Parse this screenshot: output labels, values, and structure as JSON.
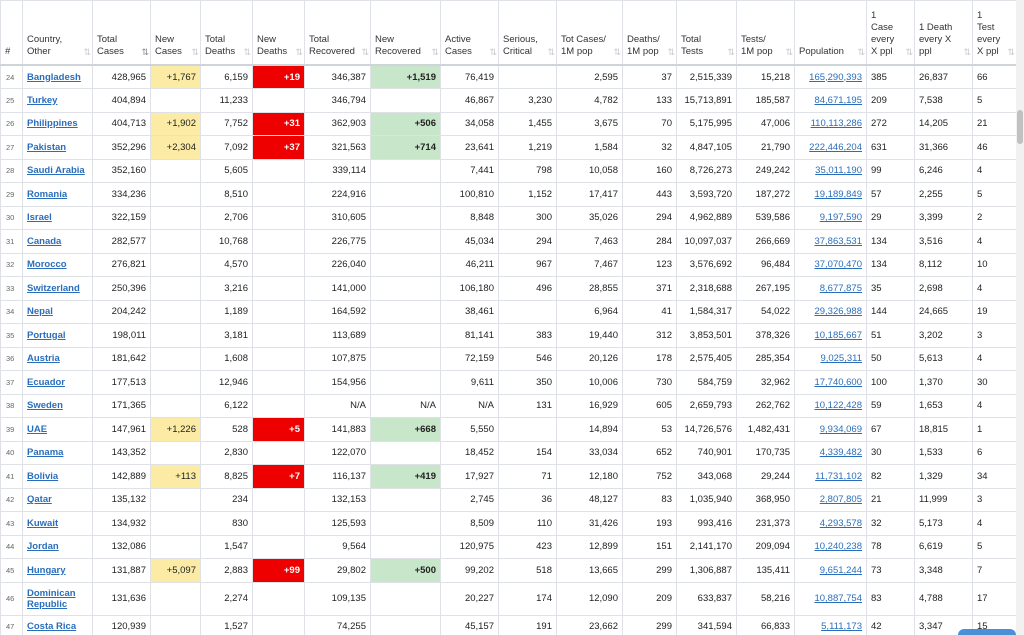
{
  "headers": [
    {
      "label": "#"
    },
    {
      "label": "Country, Other"
    },
    {
      "label": "Total Cases"
    },
    {
      "label": "New Cases"
    },
    {
      "label": "Total Deaths"
    },
    {
      "label": "New Deaths"
    },
    {
      "label": "Total Recovered"
    },
    {
      "label": "New Recovered"
    },
    {
      "label": "Active Cases"
    },
    {
      "label": "Serious, Critical"
    },
    {
      "label": "Tot Cases/ 1M pop"
    },
    {
      "label": "Deaths/ 1M pop"
    },
    {
      "label": "Total Tests"
    },
    {
      "label": "Tests/ 1M pop"
    },
    {
      "label": "Population"
    },
    {
      "label": "1 Case every X ppl"
    },
    {
      "label": "1 Death every X ppl"
    },
    {
      "label": "1 Test every X ppl"
    }
  ],
  "sort_icon": "⇅",
  "rows": [
    {
      "num": "24",
      "country": "Bangladesh",
      "total_cases": "428,965",
      "new_cases": "+1,767",
      "total_deaths": "6,159",
      "new_deaths": "+19",
      "total_recovered": "346,387",
      "new_recovered": "+1,519",
      "active": "76,419",
      "serious": "",
      "cases_1m": "2,595",
      "deaths_1m": "37",
      "tests": "2,515,339",
      "tests_1m": "15,218",
      "population": "165,290,393",
      "case_every": "385",
      "death_every": "26,837",
      "test_every": "66"
    },
    {
      "num": "25",
      "country": "Turkey",
      "total_cases": "404,894",
      "new_cases": "",
      "total_deaths": "11,233",
      "new_deaths": "",
      "total_recovered": "346,794",
      "new_recovered": "",
      "active": "46,867",
      "serious": "3,230",
      "cases_1m": "4,782",
      "deaths_1m": "133",
      "tests": "15,713,891",
      "tests_1m": "185,587",
      "population": "84,671,195",
      "case_every": "209",
      "death_every": "7,538",
      "test_every": "5"
    },
    {
      "num": "26",
      "country": "Philippines",
      "total_cases": "404,713",
      "new_cases": "+1,902",
      "total_deaths": "7,752",
      "new_deaths": "+31",
      "total_recovered": "362,903",
      "new_recovered": "+506",
      "active": "34,058",
      "serious": "1,455",
      "cases_1m": "3,675",
      "deaths_1m": "70",
      "tests": "5,175,995",
      "tests_1m": "47,006",
      "population": "110,113,286",
      "case_every": "272",
      "death_every": "14,205",
      "test_every": "21"
    },
    {
      "num": "27",
      "country": "Pakistan",
      "total_cases": "352,296",
      "new_cases": "+2,304",
      "total_deaths": "7,092",
      "new_deaths": "+37",
      "total_recovered": "321,563",
      "new_recovered": "+714",
      "active": "23,641",
      "serious": "1,219",
      "cases_1m": "1,584",
      "deaths_1m": "32",
      "tests": "4,847,105",
      "tests_1m": "21,790",
      "population": "222,446,204",
      "case_every": "631",
      "death_every": "31,366",
      "test_every": "46"
    },
    {
      "num": "28",
      "country": "Saudi Arabia",
      "total_cases": "352,160",
      "new_cases": "",
      "total_deaths": "5,605",
      "new_deaths": "",
      "total_recovered": "339,114",
      "new_recovered": "",
      "active": "7,441",
      "serious": "798",
      "cases_1m": "10,058",
      "deaths_1m": "160",
      "tests": "8,726,273",
      "tests_1m": "249,242",
      "population": "35,011,190",
      "case_every": "99",
      "death_every": "6,246",
      "test_every": "4"
    },
    {
      "num": "29",
      "country": "Romania",
      "total_cases": "334,236",
      "new_cases": "",
      "total_deaths": "8,510",
      "new_deaths": "",
      "total_recovered": "224,916",
      "new_recovered": "",
      "active": "100,810",
      "serious": "1,152",
      "cases_1m": "17,417",
      "deaths_1m": "443",
      "tests": "3,593,720",
      "tests_1m": "187,272",
      "population": "19,189,849",
      "case_every": "57",
      "death_every": "2,255",
      "test_every": "5"
    },
    {
      "num": "30",
      "country": "Israel",
      "total_cases": "322,159",
      "new_cases": "",
      "total_deaths": "2,706",
      "new_deaths": "",
      "total_recovered": "310,605",
      "new_recovered": "",
      "active": "8,848",
      "serious": "300",
      "cases_1m": "35,026",
      "deaths_1m": "294",
      "tests": "4,962,889",
      "tests_1m": "539,586",
      "population": "9,197,590",
      "case_every": "29",
      "death_every": "3,399",
      "test_every": "2"
    },
    {
      "num": "31",
      "country": "Canada",
      "total_cases": "282,577",
      "new_cases": "",
      "total_deaths": "10,768",
      "new_deaths": "",
      "total_recovered": "226,775",
      "new_recovered": "",
      "active": "45,034",
      "serious": "294",
      "cases_1m": "7,463",
      "deaths_1m": "284",
      "tests": "10,097,037",
      "tests_1m": "266,669",
      "population": "37,863,531",
      "case_every": "134",
      "death_every": "3,516",
      "test_every": "4"
    },
    {
      "num": "32",
      "country": "Morocco",
      "total_cases": "276,821",
      "new_cases": "",
      "total_deaths": "4,570",
      "new_deaths": "",
      "total_recovered": "226,040",
      "new_recovered": "",
      "active": "46,211",
      "serious": "967",
      "cases_1m": "7,467",
      "deaths_1m": "123",
      "tests": "3,576,692",
      "tests_1m": "96,484",
      "population": "37,070,470",
      "case_every": "134",
      "death_every": "8,112",
      "test_every": "10"
    },
    {
      "num": "33",
      "country": "Switzerland",
      "total_cases": "250,396",
      "new_cases": "",
      "total_deaths": "3,216",
      "new_deaths": "",
      "total_recovered": "141,000",
      "new_recovered": "",
      "active": "106,180",
      "serious": "496",
      "cases_1m": "28,855",
      "deaths_1m": "371",
      "tests": "2,318,688",
      "tests_1m": "267,195",
      "population": "8,677,875",
      "case_every": "35",
      "death_every": "2,698",
      "test_every": "4"
    },
    {
      "num": "34",
      "country": "Nepal",
      "total_cases": "204,242",
      "new_cases": "",
      "total_deaths": "1,189",
      "new_deaths": "",
      "total_recovered": "164,592",
      "new_recovered": "",
      "active": "38,461",
      "serious": "",
      "cases_1m": "6,964",
      "deaths_1m": "41",
      "tests": "1,584,317",
      "tests_1m": "54,022",
      "population": "29,326,988",
      "case_every": "144",
      "death_every": "24,665",
      "test_every": "19"
    },
    {
      "num": "35",
      "country": "Portugal",
      "total_cases": "198,011",
      "new_cases": "",
      "total_deaths": "3,181",
      "new_deaths": "",
      "total_recovered": "113,689",
      "new_recovered": "",
      "active": "81,141",
      "serious": "383",
      "cases_1m": "19,440",
      "deaths_1m": "312",
      "tests": "3,853,501",
      "tests_1m": "378,326",
      "population": "10,185,667",
      "case_every": "51",
      "death_every": "3,202",
      "test_every": "3"
    },
    {
      "num": "36",
      "country": "Austria",
      "total_cases": "181,642",
      "new_cases": "",
      "total_deaths": "1,608",
      "new_deaths": "",
      "total_recovered": "107,875",
      "new_recovered": "",
      "active": "72,159",
      "serious": "546",
      "cases_1m": "20,126",
      "deaths_1m": "178",
      "tests": "2,575,405",
      "tests_1m": "285,354",
      "population": "9,025,311",
      "case_every": "50",
      "death_every": "5,613",
      "test_every": "4"
    },
    {
      "num": "37",
      "country": "Ecuador",
      "total_cases": "177,513",
      "new_cases": "",
      "total_deaths": "12,946",
      "new_deaths": "",
      "total_recovered": "154,956",
      "new_recovered": "",
      "active": "9,611",
      "serious": "350",
      "cases_1m": "10,006",
      "deaths_1m": "730",
      "tests": "584,759",
      "tests_1m": "32,962",
      "population": "17,740,600",
      "case_every": "100",
      "death_every": "1,370",
      "test_every": "30"
    },
    {
      "num": "38",
      "country": "Sweden",
      "total_cases": "171,365",
      "new_cases": "",
      "total_deaths": "6,122",
      "new_deaths": "",
      "total_recovered": "N/A",
      "new_recovered": "N/A",
      "active": "N/A",
      "serious": "131",
      "cases_1m": "16,929",
      "deaths_1m": "605",
      "tests": "2,659,793",
      "tests_1m": "262,762",
      "population": "10,122,428",
      "case_every": "59",
      "death_every": "1,653",
      "test_every": "4"
    },
    {
      "num": "39",
      "country": "UAE",
      "total_cases": "147,961",
      "new_cases": "+1,226",
      "total_deaths": "528",
      "new_deaths": "+5",
      "total_recovered": "141,883",
      "new_recovered": "+668",
      "active": "5,550",
      "serious": "",
      "cases_1m": "14,894",
      "deaths_1m": "53",
      "tests": "14,726,576",
      "tests_1m": "1,482,431",
      "population": "9,934,069",
      "case_every": "67",
      "death_every": "18,815",
      "test_every": "1"
    },
    {
      "num": "40",
      "country": "Panama",
      "total_cases": "143,352",
      "new_cases": "",
      "total_deaths": "2,830",
      "new_deaths": "",
      "total_recovered": "122,070",
      "new_recovered": "",
      "active": "18,452",
      "serious": "154",
      "cases_1m": "33,034",
      "deaths_1m": "652",
      "tests": "740,901",
      "tests_1m": "170,735",
      "population": "4,339,482",
      "case_every": "30",
      "death_every": "1,533",
      "test_every": "6"
    },
    {
      "num": "41",
      "country": "Bolivia",
      "total_cases": "142,889",
      "new_cases": "+113",
      "total_deaths": "8,825",
      "new_deaths": "+7",
      "total_recovered": "116,137",
      "new_recovered": "+419",
      "active": "17,927",
      "serious": "71",
      "cases_1m": "12,180",
      "deaths_1m": "752",
      "tests": "343,068",
      "tests_1m": "29,244",
      "population": "11,731,102",
      "case_every": "82",
      "death_every": "1,329",
      "test_every": "34"
    },
    {
      "num": "42",
      "country": "Qatar",
      "total_cases": "135,132",
      "new_cases": "",
      "total_deaths": "234",
      "new_deaths": "",
      "total_recovered": "132,153",
      "new_recovered": "",
      "active": "2,745",
      "serious": "36",
      "cases_1m": "48,127",
      "deaths_1m": "83",
      "tests": "1,035,940",
      "tests_1m": "368,950",
      "population": "2,807,805",
      "case_every": "21",
      "death_every": "11,999",
      "test_every": "3"
    },
    {
      "num": "43",
      "country": "Kuwait",
      "total_cases": "134,932",
      "new_cases": "",
      "total_deaths": "830",
      "new_deaths": "",
      "total_recovered": "125,593",
      "new_recovered": "",
      "active": "8,509",
      "serious": "110",
      "cases_1m": "31,426",
      "deaths_1m": "193",
      "tests": "993,416",
      "tests_1m": "231,373",
      "population": "4,293,578",
      "case_every": "32",
      "death_every": "5,173",
      "test_every": "4"
    },
    {
      "num": "44",
      "country": "Jordan",
      "total_cases": "132,086",
      "new_cases": "",
      "total_deaths": "1,547",
      "new_deaths": "",
      "total_recovered": "9,564",
      "new_recovered": "",
      "active": "120,975",
      "serious": "423",
      "cases_1m": "12,899",
      "deaths_1m": "151",
      "tests": "2,141,170",
      "tests_1m": "209,094",
      "population": "10,240,238",
      "case_every": "78",
      "death_every": "6,619",
      "test_every": "5"
    },
    {
      "num": "45",
      "country": "Hungary",
      "total_cases": "131,887",
      "new_cases": "+5,097",
      "total_deaths": "2,883",
      "new_deaths": "+99",
      "total_recovered": "29,802",
      "new_recovered": "+500",
      "active": "99,202",
      "serious": "518",
      "cases_1m": "13,665",
      "deaths_1m": "299",
      "tests": "1,306,887",
      "tests_1m": "135,411",
      "population": "9,651,244",
      "case_every": "73",
      "death_every": "3,348",
      "test_every": "7"
    },
    {
      "num": "46",
      "country": "Dominican Republic",
      "total_cases": "131,636",
      "new_cases": "",
      "total_deaths": "2,274",
      "new_deaths": "",
      "total_recovered": "109,135",
      "new_recovered": "",
      "active": "20,227",
      "serious": "174",
      "cases_1m": "12,090",
      "deaths_1m": "209",
      "tests": "633,837",
      "tests_1m": "58,216",
      "population": "10,887,754",
      "case_every": "83",
      "death_every": "4,788",
      "test_every": "17"
    },
    {
      "num": "47",
      "country": "Costa Rica",
      "total_cases": "120,939",
      "new_cases": "",
      "total_deaths": "1,527",
      "new_deaths": "",
      "total_recovered": "74,255",
      "new_recovered": "",
      "active": "45,157",
      "serious": "191",
      "cases_1m": "23,662",
      "deaths_1m": "299",
      "tests": "341,594",
      "tests_1m": "66,833",
      "population": "5,111,173",
      "case_every": "42",
      "death_every": "3,347",
      "test_every": "15"
    }
  ]
}
